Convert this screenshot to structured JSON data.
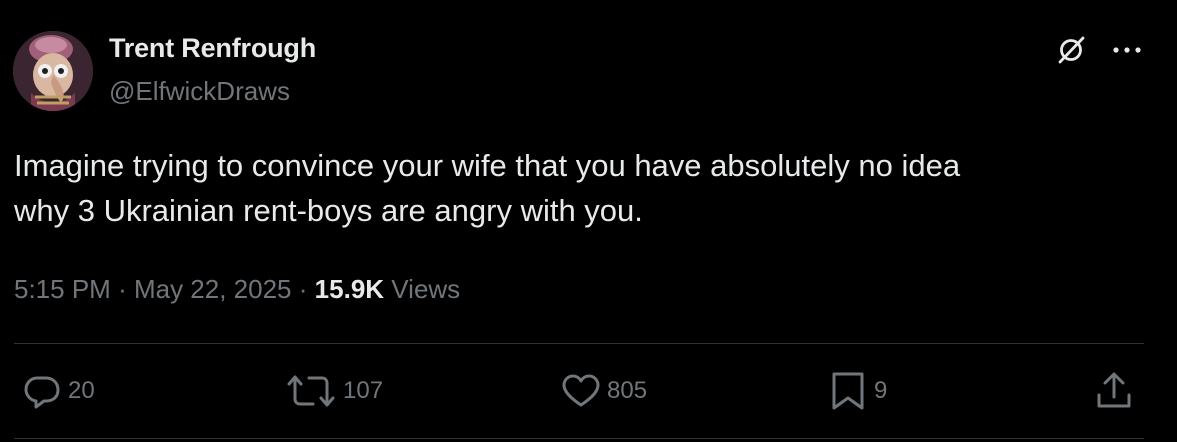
{
  "author": {
    "display_name": "Trent Renfrough",
    "handle": "@ElfwickDraws"
  },
  "tweet": {
    "text_line1": "Imagine trying to convince your wife that you have absolutely no idea",
    "text_line2": "why 3 Ukrainian rent-boys are angry with you."
  },
  "meta": {
    "time": "5:15 PM",
    "separator": "·",
    "date": "May 22, 2025",
    "views_count": "15.9K",
    "views_label": "Views"
  },
  "actions": {
    "replies": "20",
    "reposts": "107",
    "likes": "805",
    "bookmarks": "9"
  },
  "icons": {
    "grok": "grok-icon",
    "more": "more-icon",
    "reply": "reply-icon",
    "repost": "repost-icon",
    "like": "heart-icon",
    "bookmark": "bookmark-icon",
    "share": "share-icon"
  },
  "colors": {
    "background": "#000000",
    "text_primary": "#e7e9ea",
    "text_secondary": "#71767b",
    "divider": "#2f3336"
  }
}
